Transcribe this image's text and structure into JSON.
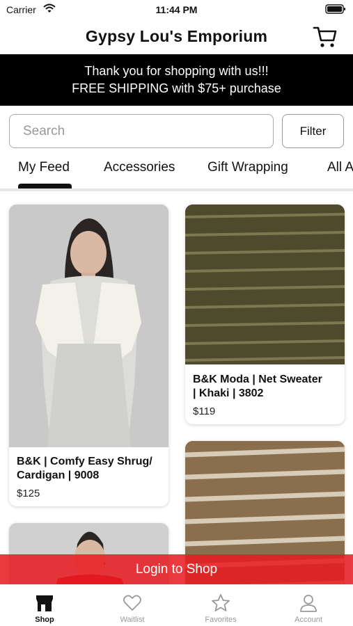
{
  "status": {
    "carrier": "Carrier",
    "time": "11:44 PM"
  },
  "header": {
    "title": "Gypsy Lou's Emporium"
  },
  "banner": {
    "line1": "Thank you for shopping with us!!!",
    "line2": "FREE SHIPPING with $75+ purchase"
  },
  "search": {
    "placeholder": "Search",
    "value": "",
    "filter_label": "Filter"
  },
  "tabs": [
    {
      "label": "My Feed",
      "active": true
    },
    {
      "label": "Accessories"
    },
    {
      "label": "Gift Wrapping"
    },
    {
      "label": "All Accessories"
    }
  ],
  "products": [
    {
      "name_line1": "B&K | Comfy Easy Shrug/",
      "name_line2": "Cardigan | 9008",
      "price": "$125"
    },
    {
      "name_line1": "B&K Moda | Net Sweater",
      "name_line2": "| Khaki | 3802",
      "price": "$119"
    }
  ],
  "login": {
    "label": "Login to Shop"
  },
  "tabbar": [
    {
      "label": "Shop",
      "icon": "shop-icon",
      "active": true
    },
    {
      "label": "Waitlist",
      "icon": "heart-icon"
    },
    {
      "label": "Favorites",
      "icon": "star-icon"
    },
    {
      "label": "Account",
      "icon": "account-icon"
    }
  ],
  "colors": {
    "banner": "#000000",
    "login_bar": "#E81A1F",
    "active_tab": "#111111",
    "inactive_tab": "#999999"
  }
}
